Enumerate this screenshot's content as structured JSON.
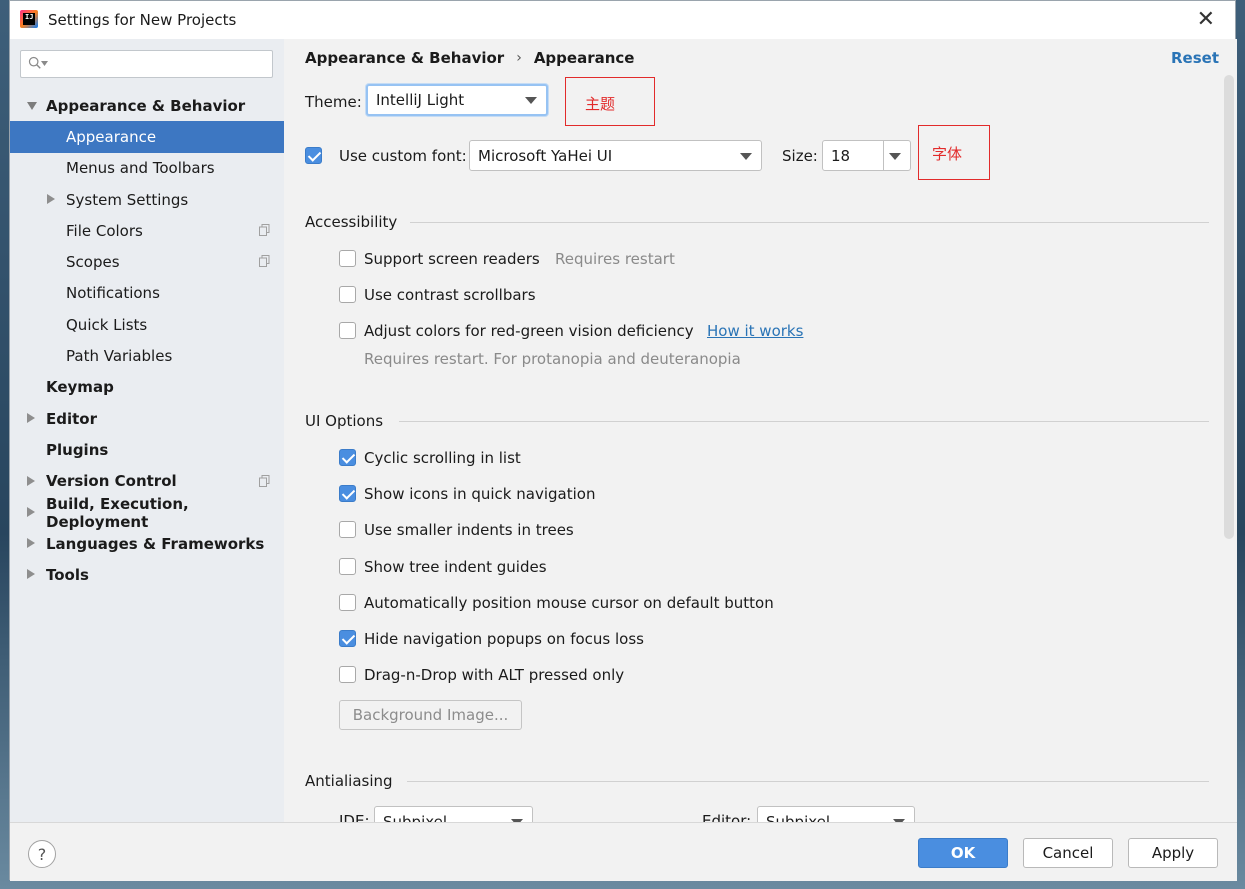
{
  "window": {
    "title": "Settings for New Projects"
  },
  "sidebar": {
    "search": {
      "placeholder": "",
      "value": ""
    },
    "items": [
      {
        "label": "Appearance & Behavior",
        "level": 0,
        "bold": true,
        "arrow": "down"
      },
      {
        "label": "Appearance",
        "level": 1,
        "selected": true
      },
      {
        "label": "Menus and Toolbars",
        "level": 1
      },
      {
        "label": "System Settings",
        "level": 1,
        "arrow": "right"
      },
      {
        "label": "File Colors",
        "level": 1,
        "copy": true
      },
      {
        "label": "Scopes",
        "level": 1,
        "copy": true
      },
      {
        "label": "Notifications",
        "level": 1
      },
      {
        "label": "Quick Lists",
        "level": 1
      },
      {
        "label": "Path Variables",
        "level": 1
      },
      {
        "label": "Keymap",
        "level": 0,
        "bold": true
      },
      {
        "label": "Editor",
        "level": 0,
        "bold": true,
        "arrow": "right"
      },
      {
        "label": "Plugins",
        "level": 0,
        "bold": true
      },
      {
        "label": "Version Control",
        "level": 0,
        "bold": true,
        "arrow": "right",
        "copy": true
      },
      {
        "label": "Build, Execution, Deployment",
        "level": 0,
        "bold": true,
        "arrow": "right"
      },
      {
        "label": "Languages & Frameworks",
        "level": 0,
        "bold": true,
        "arrow": "right"
      },
      {
        "label": "Tools",
        "level": 0,
        "bold": true,
        "arrow": "right"
      }
    ]
  },
  "content": {
    "breadcrumb": {
      "parent": "Appearance & Behavior",
      "current": "Appearance"
    },
    "reset_label": "Reset",
    "theme": {
      "label": "Theme:",
      "value": "IntelliJ Light"
    },
    "custom_font": {
      "label": "Use custom font:",
      "checked": true,
      "value": "Microsoft YaHei UI",
      "size_label": "Size:",
      "size_value": "18"
    },
    "annotations": {
      "theme_note": "主题",
      "font_note": "字体"
    },
    "accessibility": {
      "title": "Accessibility",
      "screen_readers": {
        "label": "Support screen readers",
        "hint": "Requires restart",
        "checked": false
      },
      "contrast_scrollbars": {
        "label": "Use contrast scrollbars",
        "checked": false
      },
      "color_deficiency": {
        "label": "Adjust colors for red-green vision deficiency",
        "link": "How it works",
        "hint": "Requires restart. For protanopia and deuteranopia",
        "checked": false
      }
    },
    "ui_options": {
      "title": "UI Options",
      "options": [
        {
          "label": "Cyclic scrolling in list",
          "checked": true
        },
        {
          "label": "Show icons in quick navigation",
          "checked": true
        },
        {
          "label": "Use smaller indents in trees",
          "checked": false
        },
        {
          "label": "Show tree indent guides",
          "checked": false
        },
        {
          "label": "Automatically position mouse cursor on default button",
          "checked": false
        },
        {
          "label": "Hide navigation popups on focus loss",
          "checked": true
        },
        {
          "label": "Drag-n-Drop with ALT pressed only",
          "checked": false
        }
      ],
      "background_image_label": "Background Image..."
    },
    "antialiasing": {
      "title": "Antialiasing",
      "ide_label": "IDE:",
      "ide_value": "Subpixel",
      "editor_label": "Editor:",
      "editor_value": "Subpixel"
    }
  },
  "footer": {
    "help_label": "?",
    "ok_label": "OK",
    "cancel_label": "Cancel",
    "apply_label": "Apply"
  },
  "colors": {
    "selection": "#3d77c2",
    "accent": "#4a8ee0",
    "link": "#2a74b6",
    "annotation": "#e22b2b"
  }
}
